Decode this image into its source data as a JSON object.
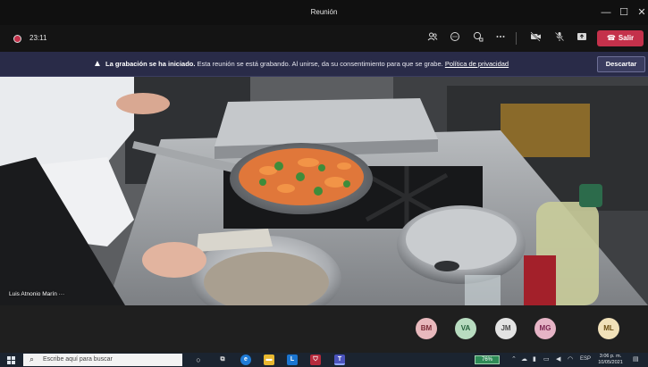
{
  "window": {
    "title": "Reunión",
    "controls": [
      "—",
      "☐",
      "✕"
    ]
  },
  "toolbar": {
    "timer": "23:11",
    "leave_label": "Salir",
    "icons": [
      "people-icon",
      "chat-icon",
      "reactions-icon",
      "more-icon",
      "camera-off-icon",
      "mic-off-icon",
      "share-icon"
    ]
  },
  "banner": {
    "bold_text": "La grabación se ha iniciado.",
    "message": " Esta reunión se está grabando. Al unirse, da su consentimiento para que se grabe. ",
    "link_text": "Política de privacidad",
    "dismiss_label": "Descartar"
  },
  "video": {
    "speaker_name": "Luis Atnonio Marín  ···"
  },
  "participants": [
    {
      "initials": "BM",
      "bg": "#e8b9bd",
      "fg": "#7a2b36"
    },
    {
      "initials": "VA",
      "bg": "#b8dcc0",
      "fg": "#23603a"
    },
    {
      "initials": "JM",
      "bg": "#e3e3e3",
      "fg": "#4a4a4a"
    },
    {
      "initials": "MG",
      "bg": "#e6b4c6",
      "fg": "#7a2450"
    },
    {
      "initials": "ML",
      "bg": "#f1e1b9",
      "fg": "#6a4d12"
    }
  ],
  "taskbar": {
    "search_placeholder": "Escribe aquí para buscar",
    "tray_badge": "76%",
    "language": "ESP",
    "time": "3:06 p. m.",
    "date": "10/05/2021"
  },
  "colors": {
    "leave": "#c4314b",
    "banner": "#292b48",
    "taskbar": "#1b2430"
  }
}
